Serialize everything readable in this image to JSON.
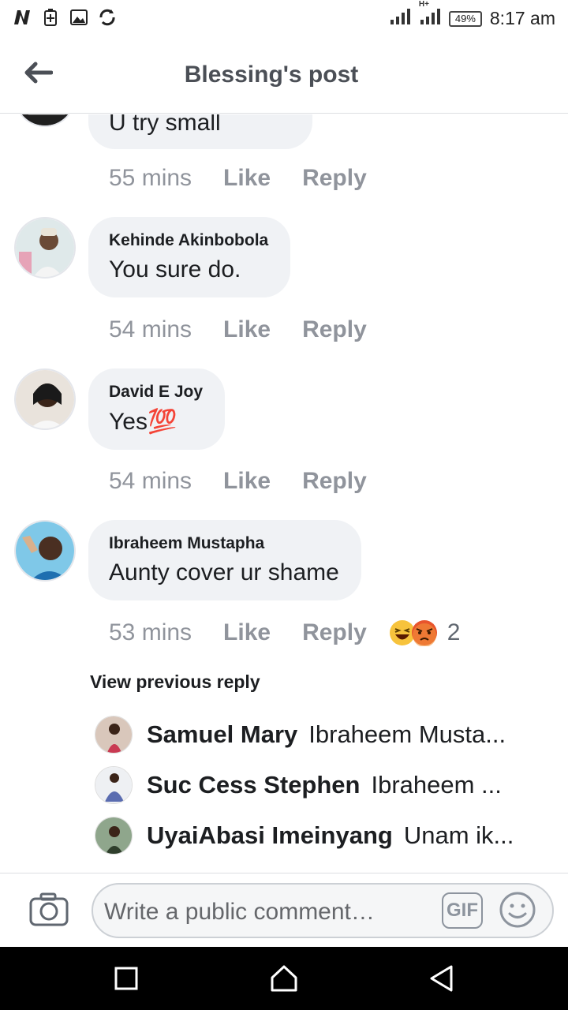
{
  "status_bar": {
    "battery": "49%",
    "time": "8:17 am",
    "network": "H+"
  },
  "header": {
    "title": "Blessing's post"
  },
  "comments": [
    {
      "text": "U try small",
      "time": "55 mins",
      "like": "Like",
      "reply": "Reply"
    },
    {
      "author": "Kehinde Akinbobola",
      "text": "You sure do.",
      "time": "54 mins",
      "like": "Like",
      "reply": "Reply"
    },
    {
      "author": "David E Joy",
      "text": "Yes💯",
      "time": "54 mins",
      "like": "Like",
      "reply": "Reply"
    },
    {
      "author": "Ibraheem Mustapha",
      "text": "Aunty cover ur shame",
      "time": "53 mins",
      "like": "Like",
      "reply": "Reply",
      "reaction_count": "2",
      "reactions": [
        "haha-icon",
        "angry-icon"
      ]
    }
  ],
  "view_previous": "View previous reply",
  "replies": [
    {
      "name": "Samuel Mary",
      "text": "Ibraheem Musta..."
    },
    {
      "name": "Suc Cess Stephen",
      "text": "Ibraheem ..."
    },
    {
      "name": "UyaiAbasi Imeinyang",
      "text": "Unam ik..."
    }
  ],
  "composer": {
    "placeholder": "Write a public comment…",
    "gif_label": "GIF"
  },
  "colors": {
    "bubble_bg": "#f0f2f5",
    "meta_gray": "#90949c",
    "header_text": "#4b4f56"
  }
}
